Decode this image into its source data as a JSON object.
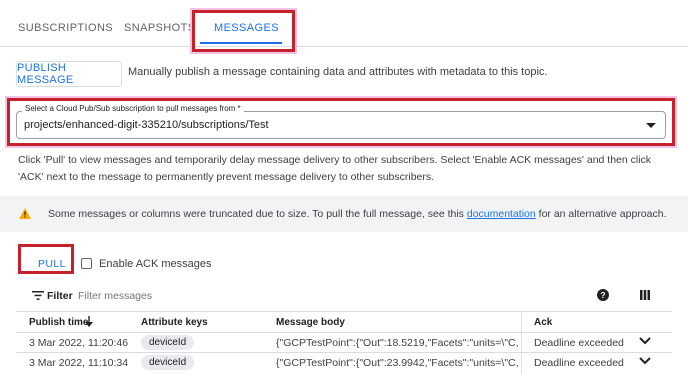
{
  "tabs": [
    {
      "label": "SUBSCRIPTIONS"
    },
    {
      "label": "SNAPSHOTS"
    },
    {
      "label": "MESSAGES"
    }
  ],
  "publish": {
    "button_label": "PUBLISH MESSAGE",
    "description": "Manually publish a message containing data and attributes with metadata to this topic."
  },
  "subscription_select": {
    "label": "Select a Cloud Pub/Sub subscription to pull messages from *",
    "value": "projects/enhanced-digit-335210/subscriptions/Test"
  },
  "info_text": "Click 'Pull' to view messages and temporarily delay message delivery to other subscribers. Select 'Enable ACK messages' and then click 'ACK' next to the message to permanently prevent message delivery to other subscribers.",
  "warning": {
    "text_before": "Some messages or columns were truncated due to size. To pull the full message, see this ",
    "link": "documentation",
    "text_after": " for an alternative approach.",
    "icon": "warning-icon",
    "icon_color": "#f9ab00"
  },
  "pull": {
    "button_label": "PULL",
    "ack_label": "Enable ACK messages",
    "ack_checked": false
  },
  "filter": {
    "label": "Filter",
    "placeholder": "Filter messages"
  },
  "table": {
    "columns": [
      "Publish time",
      "Attribute keys",
      "Message body",
      "Ack"
    ],
    "rows": [
      {
        "publish_time": "3 Mar 2022, 11:20:46",
        "attribute": "deviceId",
        "body": "{\"GCPTestPoint\":{\"Out\":18.5219,\"Facets\":\"units=\\\"C,precision",
        "ack": "Deadline exceeded"
      },
      {
        "publish_time": "3 Mar 2022, 11:10:34",
        "attribute": "deviceId",
        "body": "{\"GCPTestPoint\":{\"Out\":23.9942,\"Facets\":\"units=\\\"C,precision",
        "ack": "Deadline exceeded"
      }
    ]
  },
  "colors": {
    "accent": "#1a73e8",
    "highlight_box": "#c5222c"
  }
}
